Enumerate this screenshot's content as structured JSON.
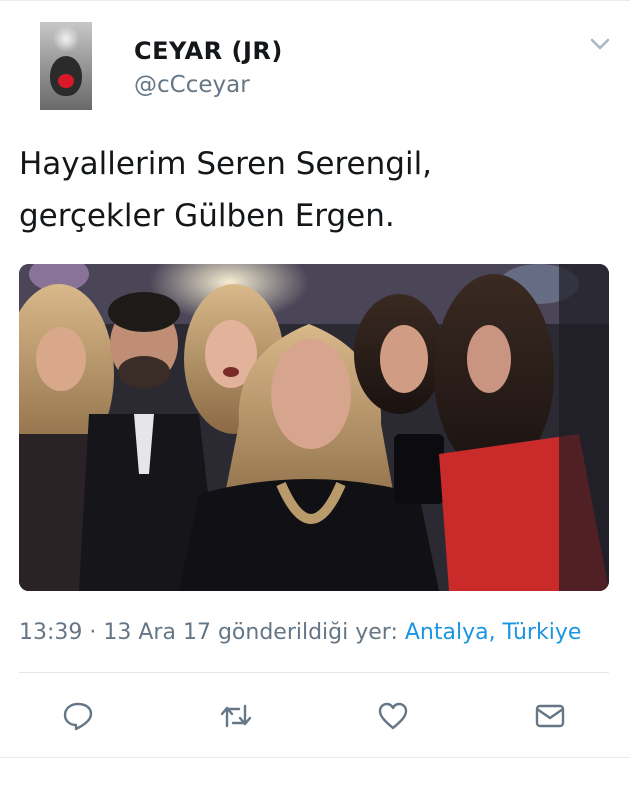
{
  "tweet": {
    "author_name": "CEYAR (JR)",
    "author_handle": "@cCceyar",
    "text_line1": "Hayallerim Seren Serengil,",
    "text_line2": "gerçekler Gülben Ergen.",
    "time": "13:39",
    "separator": " · ",
    "date": "13 Ara 17",
    "location_prefix": " gönderildiği yer: ",
    "location": "Antalya, Türkiye"
  },
  "icons": {
    "avatar": "profile-avatar",
    "menu": "chevron-down-icon",
    "reply": "reply-icon",
    "retweet": "retweet-icon",
    "like": "heart-icon",
    "dm": "mail-icon"
  },
  "colors": {
    "text": "#14171a",
    "secondary": "#657786",
    "link": "#1b95e0",
    "divider": "#e1e8ed"
  }
}
